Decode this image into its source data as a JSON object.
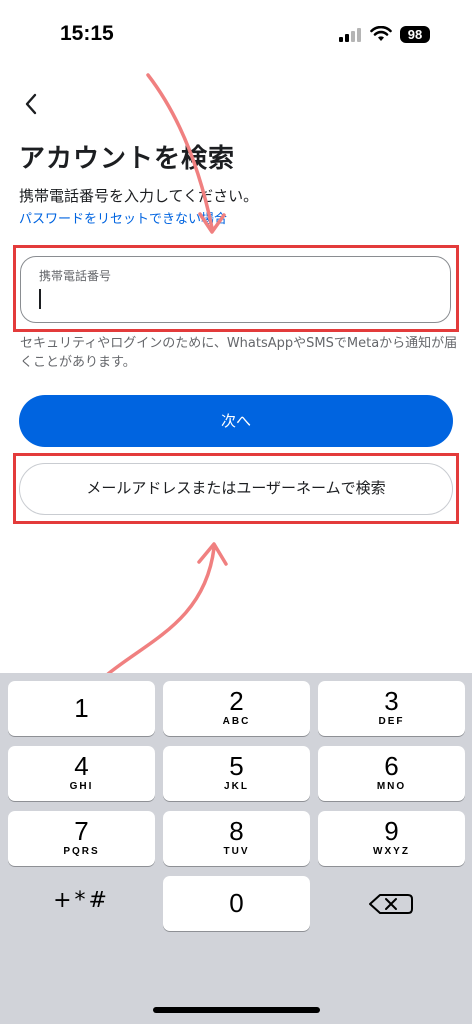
{
  "status_bar": {
    "time": "15:15",
    "battery": "98"
  },
  "page": {
    "title": "アカウントを検索",
    "subtitle": "携帯電話番号を入力してください。",
    "reset_link": "パスワードをリセットできない場合"
  },
  "phone_field": {
    "label": "携帯電話番号",
    "value": ""
  },
  "helper_text": "セキュリティやログインのために、WhatsAppやSMSでMetaから通知が届くことがあります。",
  "buttons": {
    "next": "次へ",
    "email_search": "メールアドレスまたはユーザーネームで検索"
  },
  "keyboard": {
    "keys": [
      {
        "digit": "1",
        "letters": ""
      },
      {
        "digit": "2",
        "letters": "ABC"
      },
      {
        "digit": "3",
        "letters": "DEF"
      },
      {
        "digit": "4",
        "letters": "GHI"
      },
      {
        "digit": "5",
        "letters": "JKL"
      },
      {
        "digit": "6",
        "letters": "MNO"
      },
      {
        "digit": "7",
        "letters": "PQRS"
      },
      {
        "digit": "8",
        "letters": "TUV"
      },
      {
        "digit": "9",
        "letters": "WXYZ"
      },
      {
        "digit": "0",
        "letters": ""
      }
    ],
    "symbols": "+*#"
  },
  "colors": {
    "primary": "#0064e0",
    "highlight": "#e33b3b",
    "annotation_arrow": "#f08080",
    "keyboard_bg": "#d1d3d9"
  }
}
